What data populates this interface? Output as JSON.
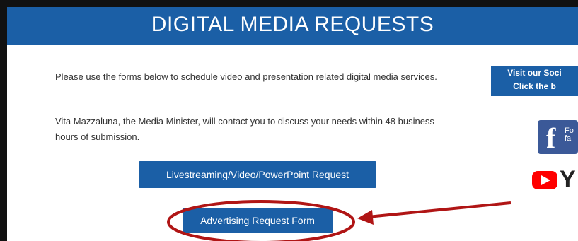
{
  "header": {
    "title": "DIGITAL MEDIA REQUESTS"
  },
  "main": {
    "intro": "Please use the forms below to schedule video and presentation related digital media services.",
    "contact": "Vita Mazzaluna, the Media Minister, will contact you to discuss your needs within 48 business hours of submission.",
    "buttons": {
      "livestream": "Livestreaming/Video/PowerPoint Request",
      "advertising": "Advertising Request Form"
    }
  },
  "sidebar": {
    "social_line1": "Visit our Soci",
    "social_line2": "Click the b",
    "facebook_small_1": "Fo",
    "facebook_small_2": "fa",
    "facebook_glyph": "f",
    "youtube_text": "Y",
    "icons": [
      "facebook-icon",
      "youtube-icon"
    ]
  },
  "colors": {
    "brand_blue": "#1b5fa6",
    "annotation_red": "#b01515",
    "facebook_blue": "#3b5998",
    "youtube_red": "#ff0000"
  }
}
